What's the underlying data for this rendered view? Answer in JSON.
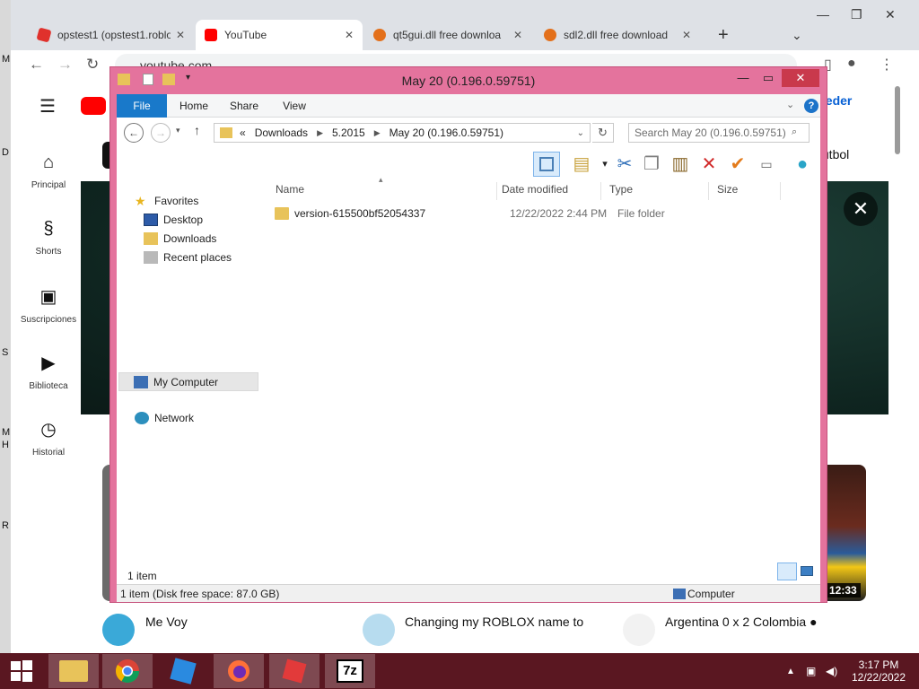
{
  "browser": {
    "tabs": [
      {
        "title": "opstest1 (opstest1.roblo",
        "favicon_color": "#e0312c"
      },
      {
        "title": "YouTube",
        "favicon_color": "#ff0000"
      },
      {
        "title": "qt5gui.dll free downloa",
        "favicon_color": "#e3701b"
      },
      {
        "title": "sdl2.dll free download",
        "favicon_color": "#e3701b"
      }
    ],
    "new_tab_icon": "plus-icon",
    "url": "youtube.com"
  },
  "youtube": {
    "sign_in_fragment": "ceder",
    "chip_fragment": "fútbol",
    "nav": [
      {
        "label": "Principal",
        "icon": "home-icon"
      },
      {
        "label": "Shorts",
        "icon": "shorts-icon"
      },
      {
        "label": "Suscripciones",
        "icon": "subscriptions-icon"
      },
      {
        "label": "Biblioteca",
        "icon": "library-icon"
      },
      {
        "label": "Historial",
        "icon": "history-icon"
      }
    ],
    "videos": [
      {
        "title": "Me Voy"
      },
      {
        "title": "Changing my ROBLOX name to"
      },
      {
        "title": "Argentina 0 x 2 Colombia ●"
      }
    ],
    "duration": "12:33"
  },
  "explorer": {
    "title": "May 20 (0.196.0.59751)",
    "ribbon_tabs": [
      "File",
      "Home",
      "Share",
      "View"
    ],
    "breadcrumb": [
      "Downloads",
      "5.2015",
      "May 20 (0.196.0.59751)"
    ],
    "breadcrumb_prefix": "«",
    "search_placeholder": "Search May 20 (0.196.0.59751)",
    "nav": {
      "favorites": "Favorites",
      "desktop": "Desktop",
      "downloads": "Downloads",
      "recent": "Recent places",
      "my_computer": "My Computer",
      "network": "Network"
    },
    "columns": {
      "name": "Name",
      "date": "Date modified",
      "type": "Type",
      "size": "Size"
    },
    "files": [
      {
        "name": "version-615500bf52054337",
        "date": "12/22/2022 2:44 PM",
        "type": "File folder",
        "size": ""
      }
    ],
    "item_count": "1 item",
    "status_free": "1 item (Disk free space: 87.0 GB)",
    "status_location": "Computer"
  },
  "desktop_labels": [
    "M",
    "D",
    "S",
    "M",
    "H",
    "R"
  ],
  "taskbar": {
    "clock_time": "3:17 PM",
    "clock_date": "12/22/2022",
    "accent": "#5a1721"
  }
}
